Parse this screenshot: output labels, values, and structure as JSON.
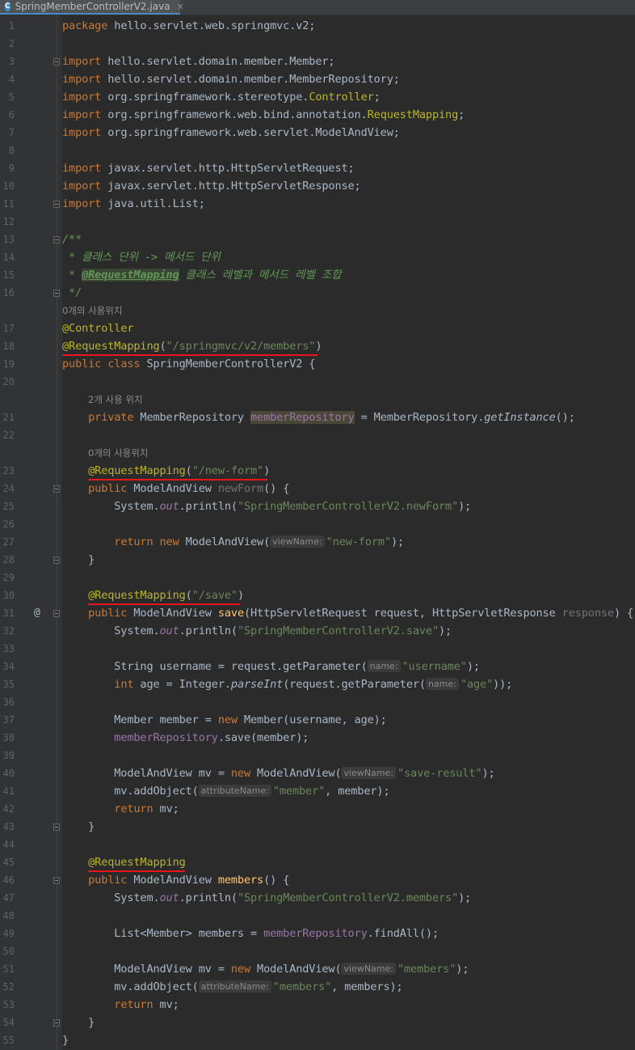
{
  "tab": {
    "icon": "C",
    "title": "SpringMemberControllerV2.java",
    "close": "✕"
  },
  "hints": {
    "usages_0_a": "0개의 사용위치",
    "usages_2": "2개 사용 위치",
    "usages_0_b": "0개의 사용위치"
  },
  "gutter": {
    "override_marker": "@"
  },
  "lines": [
    {
      "n": "1",
      "segs": [
        [
          "kw",
          "package"
        ],
        [
          "",
          "hello.servlet.web.springmvc.v2;"
        ]
      ]
    },
    {
      "n": "2",
      "segs": []
    },
    {
      "n": "3",
      "segs": [
        [
          "kw",
          "import"
        ],
        [
          "",
          "hello.servlet.domain.member.Member;"
        ]
      ]
    },
    {
      "n": "4",
      "segs": [
        [
          "kw",
          "import"
        ],
        [
          "",
          "hello.servlet.domain.member.MemberRepository;"
        ]
      ]
    },
    {
      "n": "5",
      "segs": [
        [
          "kw",
          "import"
        ],
        [
          "",
          "org.springframework.stereotype."
        ],
        [
          "ann",
          "Controller"
        ],
        [
          "",
          ";"
        ]
      ]
    },
    {
      "n": "6",
      "segs": [
        [
          "kw",
          "import"
        ],
        [
          "",
          "org.springframework.web.bind.annotation."
        ],
        [
          "ann",
          "RequestMapping"
        ],
        [
          "",
          ";"
        ]
      ]
    },
    {
      "n": "7",
      "segs": [
        [
          "kw",
          "import"
        ],
        [
          "",
          "org.springframework.web.servlet.ModelAndView;"
        ]
      ]
    },
    {
      "n": "8",
      "segs": []
    },
    {
      "n": "9",
      "segs": [
        [
          "kw",
          "import"
        ],
        [
          "",
          "javax.servlet.http.HttpServletRequest;"
        ]
      ]
    },
    {
      "n": "10",
      "segs": [
        [
          "kw",
          "import"
        ],
        [
          "",
          "javax.servlet.http.HttpServletResponse;"
        ]
      ]
    },
    {
      "n": "11",
      "segs": [
        [
          "kw",
          "import"
        ],
        [
          "",
          "java.util.List;"
        ]
      ]
    },
    {
      "n": "12",
      "segs": []
    },
    {
      "n": "13",
      "segs": [
        [
          "cm",
          "/**"
        ]
      ]
    },
    {
      "n": "14",
      "segs": [
        [
          "cm",
          " * 클래스 단위 -> 메서드 단위"
        ]
      ]
    },
    {
      "n": "15",
      "segs": [
        [
          "cm",
          " * "
        ],
        [
          "cm-tag",
          "@RequestMapping"
        ],
        [
          "cm",
          " 클래스 레벨과 메서드 레벨 조합"
        ]
      ]
    },
    {
      "n": "16",
      "segs": [
        [
          "cm",
          " */"
        ]
      ]
    },
    {
      "n": "17",
      "segs": [
        [
          "ann",
          "@Controller"
        ]
      ]
    },
    {
      "n": "18",
      "segs": [
        [
          "ann",
          "@RequestMapping"
        ],
        [
          "",
          "("
        ],
        [
          "str",
          "\"/springmvc/v2/members\""
        ],
        [
          "",
          ")"
        ]
      ]
    },
    {
      "n": "19",
      "segs": [
        [
          "kw",
          "public class "
        ],
        [
          "",
          "SpringMemberControllerV2 {"
        ]
      ]
    },
    {
      "n": "20",
      "segs": []
    },
    {
      "n": "21",
      "segs": [
        [
          "",
          "    "
        ],
        [
          "kw",
          "private "
        ],
        [
          "",
          "MemberRepository "
        ],
        [
          "fld-hl",
          "memberRepository"
        ],
        [
          "",
          " = MemberRepository."
        ],
        [
          "smeth",
          "getInstance"
        ],
        [
          "",
          "();"
        ]
      ]
    },
    {
      "n": "22",
      "segs": []
    },
    {
      "n": "23",
      "segs": [
        [
          "",
          "    "
        ],
        [
          "ann",
          "@RequestMapping"
        ],
        [
          "",
          "("
        ],
        [
          "str",
          "\"/new-form\""
        ],
        [
          "",
          ")"
        ]
      ]
    },
    {
      "n": "24",
      "segs": [
        [
          "",
          "    "
        ],
        [
          "kw",
          "public "
        ],
        [
          "",
          "ModelAndView "
        ],
        [
          "unused",
          "newForm"
        ],
        [
          "",
          "() {"
        ]
      ]
    },
    {
      "n": "25",
      "segs": [
        [
          "",
          "        System."
        ],
        [
          "static",
          "out"
        ],
        [
          "",
          ".println("
        ],
        [
          "str",
          "\"SpringMemberControllerV2.newForm\""
        ],
        [
          "",
          ");"
        ]
      ]
    },
    {
      "n": "26",
      "segs": []
    },
    {
      "n": "27",
      "segs": [
        [
          "",
          "        "
        ],
        [
          "kw",
          "return new "
        ],
        [
          "",
          "ModelAndView("
        ],
        [
          "param",
          "viewName:"
        ],
        [
          "str",
          "\"new-form\""
        ],
        [
          "",
          ");"
        ]
      ]
    },
    {
      "n": "28",
      "segs": [
        [
          "",
          "    }"
        ]
      ]
    },
    {
      "n": "29",
      "segs": []
    },
    {
      "n": "30",
      "segs": [
        [
          "",
          "    "
        ],
        [
          "ann",
          "@RequestMapping"
        ],
        [
          "",
          "("
        ],
        [
          "str",
          "\"/save\""
        ],
        [
          "",
          ")"
        ]
      ]
    },
    {
      "n": "31",
      "segs": [
        [
          "",
          "    "
        ],
        [
          "kw",
          "public "
        ],
        [
          "",
          "ModelAndView "
        ],
        [
          "fn",
          "save"
        ],
        [
          "",
          "(HttpServletRequest request, HttpServletResponse "
        ],
        [
          "unused",
          "response"
        ],
        [
          "",
          ") {"
        ]
      ]
    },
    {
      "n": "32",
      "segs": [
        [
          "",
          "        System."
        ],
        [
          "static",
          "out"
        ],
        [
          "",
          ".println("
        ],
        [
          "str",
          "\"SpringMemberControllerV2.save\""
        ],
        [
          "",
          ");"
        ]
      ]
    },
    {
      "n": "33",
      "segs": []
    },
    {
      "n": "34",
      "segs": [
        [
          "",
          "        String username = request.getParameter("
        ],
        [
          "param",
          "name:"
        ],
        [
          "str",
          "\"username\""
        ],
        [
          "",
          ");"
        ]
      ]
    },
    {
      "n": "35",
      "segs": [
        [
          "",
          "        "
        ],
        [
          "kw",
          "int "
        ],
        [
          "",
          "age = Integer."
        ],
        [
          "smeth",
          "parseInt"
        ],
        [
          "",
          "(request.getParameter("
        ],
        [
          "param",
          "name:"
        ],
        [
          "str",
          "\"age\""
        ],
        [
          "",
          "));"
        ]
      ]
    },
    {
      "n": "36",
      "segs": []
    },
    {
      "n": "37",
      "segs": [
        [
          "",
          "        Member member = "
        ],
        [
          "kw",
          "new "
        ],
        [
          "",
          "Member(username, age);"
        ]
      ]
    },
    {
      "n": "38",
      "segs": [
        [
          "",
          "        "
        ],
        [
          "fld",
          "memberRepository"
        ],
        [
          "",
          ".save(member);"
        ]
      ]
    },
    {
      "n": "39",
      "segs": []
    },
    {
      "n": "40",
      "segs": [
        [
          "",
          "        ModelAndView mv = "
        ],
        [
          "kw",
          "new "
        ],
        [
          "",
          "ModelAndView("
        ],
        [
          "param",
          "viewName:"
        ],
        [
          "str",
          "\"save-result\""
        ],
        [
          "",
          ");"
        ]
      ]
    },
    {
      "n": "41",
      "segs": [
        [
          "",
          "        mv.addObject("
        ],
        [
          "param",
          "attributeName:"
        ],
        [
          "str",
          "\"member\""
        ],
        [
          "",
          ", member);"
        ]
      ]
    },
    {
      "n": "42",
      "segs": [
        [
          "",
          "        "
        ],
        [
          "kw",
          "return "
        ],
        [
          "",
          "mv;"
        ]
      ]
    },
    {
      "n": "43",
      "segs": [
        [
          "",
          "    }"
        ]
      ]
    },
    {
      "n": "44",
      "segs": []
    },
    {
      "n": "45",
      "segs": [
        [
          "",
          "    "
        ],
        [
          "ann",
          "@RequestMapping"
        ]
      ]
    },
    {
      "n": "46",
      "segs": [
        [
          "",
          "    "
        ],
        [
          "kw",
          "public "
        ],
        [
          "",
          "ModelAndView "
        ],
        [
          "fn",
          "members"
        ],
        [
          "",
          "() {"
        ]
      ]
    },
    {
      "n": "47",
      "segs": [
        [
          "",
          "        System."
        ],
        [
          "static",
          "out"
        ],
        [
          "",
          ".println("
        ],
        [
          "str",
          "\"SpringMemberControllerV2.members\""
        ],
        [
          "",
          ");"
        ]
      ]
    },
    {
      "n": "48",
      "segs": []
    },
    {
      "n": "49",
      "segs": [
        [
          "",
          "        List<Member> members = "
        ],
        [
          "fld",
          "memberRepository"
        ],
        [
          "",
          ".findAll();"
        ]
      ]
    },
    {
      "n": "50",
      "segs": []
    },
    {
      "n": "51",
      "segs": [
        [
          "",
          "        ModelAndView mv = "
        ],
        [
          "kw",
          "new "
        ],
        [
          "",
          "ModelAndView("
        ],
        [
          "param",
          "viewName:"
        ],
        [
          "str",
          "\"members\""
        ],
        [
          "",
          ");"
        ]
      ]
    },
    {
      "n": "52",
      "segs": [
        [
          "",
          "        mv.addObject("
        ],
        [
          "param",
          "attributeName:"
        ],
        [
          "str",
          "\"members\""
        ],
        [
          "",
          ", members);"
        ]
      ]
    },
    {
      "n": "53",
      "segs": [
        [
          "",
          "        "
        ],
        [
          "kw",
          "return "
        ],
        [
          "",
          "mv;"
        ]
      ]
    },
    {
      "n": "54",
      "segs": [
        [
          "",
          "    }"
        ]
      ]
    },
    {
      "n": "55",
      "segs": [
        [
          "",
          "}"
        ]
      ]
    }
  ],
  "colors": {
    "background": "#2b2b2b",
    "gutter": "#313335",
    "keyword": "#cc7832",
    "annotation": "#bbb529",
    "string": "#6a8759",
    "field": "#9876aa",
    "method_decl": "#ffc66d",
    "comment": "#629755",
    "underline": "#e8161b"
  }
}
